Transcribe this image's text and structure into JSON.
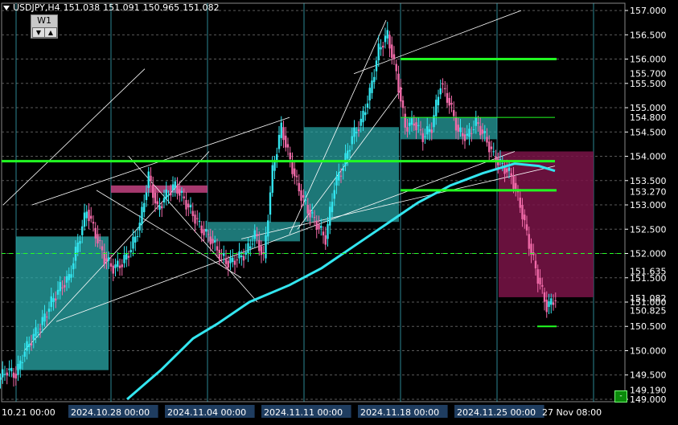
{
  "header": {
    "symbol": "USDJPY,H4",
    "open": "151.038",
    "high": "151.091",
    "low": "150.965",
    "close": "151.082"
  },
  "timeframe_panel": {
    "label": "W1",
    "down_icon": "triangle-down-icon",
    "up_icon": "triangle-up-icon"
  },
  "colors": {
    "background": "#000000",
    "bull_candle": "#33e6f0",
    "bear_candle": "#f06aa8",
    "moving_average": "#33e6f0",
    "level_line": "#22ff22",
    "demand_zone": "#2aa9a9",
    "supply_zone": "#7a1448",
    "grid": "#5a5a5a",
    "axis_text": "#ffffff"
  },
  "chart_data": {
    "type": "candlestick",
    "y_axis_ticks": [
      "157.000",
      "156.500",
      "156.000",
      "155.500",
      "155.000",
      "154.500",
      "154.000",
      "153.500",
      "153.000",
      "152.500",
      "152.000",
      "151.500",
      "151.000",
      "150.500",
      "150.000",
      "149.500",
      "149.000"
    ],
    "y_axis_labels": [
      {
        "value": 155.7,
        "label": "155.700"
      },
      {
        "value": 154.8,
        "label": "154.800"
      },
      {
        "value": 153.27,
        "label": "153.270"
      },
      {
        "value": 151.635,
        "label": "151.635"
      },
      {
        "value": 151.082,
        "label": "151.082"
      },
      {
        "value": 150.825,
        "label": "150.825"
      },
      {
        "value": 149.19,
        "label": "149.190"
      }
    ],
    "ylim": [
      148.95,
      157.15
    ],
    "x_axis_labels": [
      "10.21 00:00",
      "2024.10.28 00:00",
      "2024.11.04 00:00",
      "2024.11.11 00:00",
      "2024.11.18 00:00",
      "2024.11.25 00:00",
      "27 Nov 08:00"
    ],
    "horizontal_levels": [
      153.9,
      156.0,
      153.3,
      154.8,
      150.5
    ],
    "dashed_level": 152.0,
    "candles_close_path": [
      149.6,
      149.5,
      150.0,
      150.3,
      150.6,
      151.0,
      151.3,
      151.5,
      152.2,
      152.9,
      152.4,
      151.9,
      151.7,
      151.8,
      152.1,
      152.6,
      153.6,
      152.9,
      153.2,
      153.4,
      153.1,
      152.8,
      152.5,
      152.3,
      152.0,
      151.8,
      151.9,
      152.0,
      152.4,
      151.9,
      153.7,
      154.6,
      153.9,
      153.3,
      152.9,
      152.6,
      152.3,
      153.4,
      153.8,
      154.4,
      154.7,
      155.3,
      156.2,
      156.5,
      155.7,
      154.6,
      154.7,
      154.4,
      154.6,
      155.5,
      155.1,
      154.5,
      154.4,
      154.7,
      154.4,
      154.0,
      153.8,
      153.6,
      153.0,
      152.2,
      151.5,
      150.9,
      151.08
    ]
  }
}
